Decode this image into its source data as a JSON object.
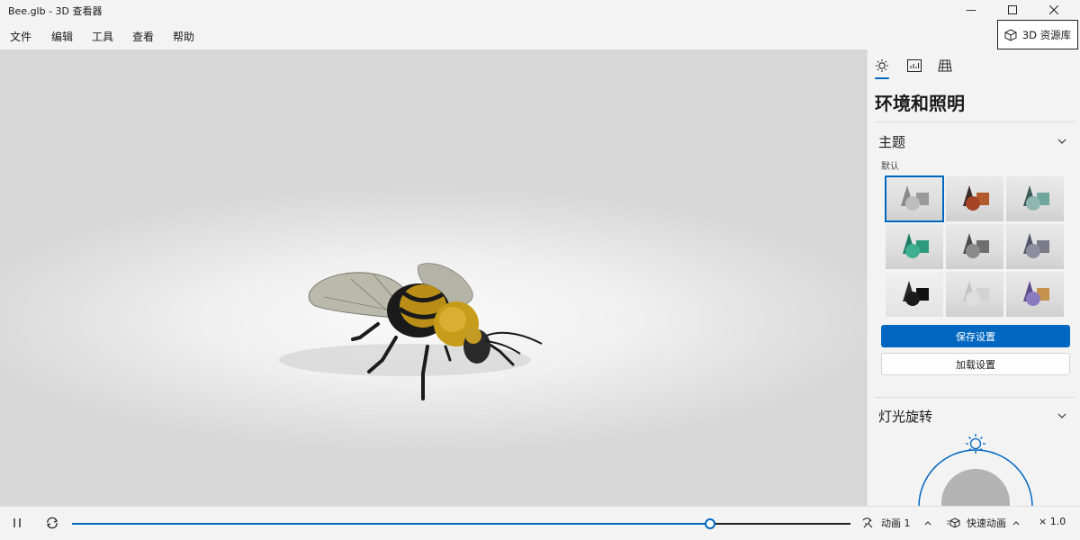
{
  "window": {
    "title": "Bee.glb - 3D 查看器"
  },
  "menu": {
    "items": [
      "文件",
      "编辑",
      "工具",
      "查看",
      "帮助"
    ],
    "library_button": "3D 资源库"
  },
  "panel": {
    "tabs": [
      "lighting-tab",
      "stats-tab",
      "grid-tab"
    ],
    "title": "环境和照明",
    "theme": {
      "heading": "主题",
      "label": "默认",
      "swatches": [
        {
          "name": "default-theme",
          "selected": true
        },
        {
          "name": "warm-theme",
          "selected": false
        },
        {
          "name": "teal-theme",
          "selected": false
        },
        {
          "name": "green-theme",
          "selected": false
        },
        {
          "name": "gray-theme",
          "selected": false
        },
        {
          "name": "purple-gray-theme",
          "selected": false
        },
        {
          "name": "dark-theme",
          "selected": false
        },
        {
          "name": "light-theme",
          "selected": false
        },
        {
          "name": "multi-color-theme",
          "selected": false
        }
      ]
    },
    "save_button": "保存设置",
    "load_button": "加载设置",
    "light_rotation": {
      "heading": "灯光旋转"
    }
  },
  "playback": {
    "progress": 0.82,
    "animation_label": "动画 1",
    "quick_animation_label": "快速动画",
    "speed_label": "× 1.0"
  },
  "colors": {
    "accent": "#0067c0"
  }
}
